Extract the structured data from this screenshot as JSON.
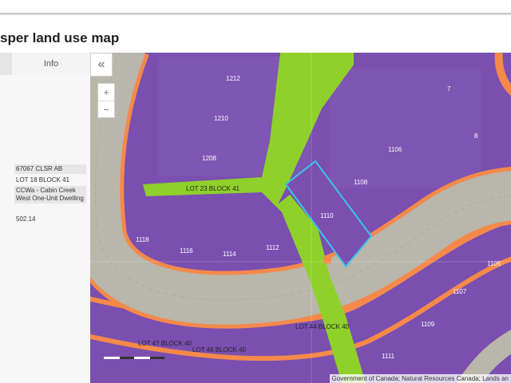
{
  "page": {
    "title": "sper land use map"
  },
  "panel": {
    "tabs": [
      {
        "label": ""
      },
      {
        "label": "Info"
      }
    ],
    "attributes": [
      {
        "value": "67067 CLSR AB"
      },
      {
        "value": "LOT 18 BLOCK 41"
      },
      {
        "value": "CCWa - Cabin Creek West One-Unit Dwelling"
      },
      {
        "value": "502.14"
      }
    ]
  },
  "controls": {
    "collapse_icon": "double-chevron-left-icon",
    "collapse_glyph": "«",
    "zoom_in": "+",
    "zoom_out": "−"
  },
  "map": {
    "colors": {
      "residential": "#7a4fb0",
      "greenspace": "#8fd12a",
      "road_border": "#f4894a",
      "road": "#b9b6ab",
      "selection": "#38c5e8"
    },
    "lot_numbers": [
      "1212",
      "7",
      "1210",
      "8",
      "1106",
      "1208",
      "1108",
      "1110",
      "1118",
      "1116",
      "1114",
      "1112",
      "1105",
      "1107",
      "1109",
      "1111"
    ],
    "lot_labels": [
      "LOT 23 BLOCK 41",
      "LOT 44 BLOCK 40",
      "LOT 47 BLOCK 40",
      "LOT 46 BLOCK 40"
    ],
    "attribution": "Government of Canada; Natural Resources Canada; Lands an"
  }
}
